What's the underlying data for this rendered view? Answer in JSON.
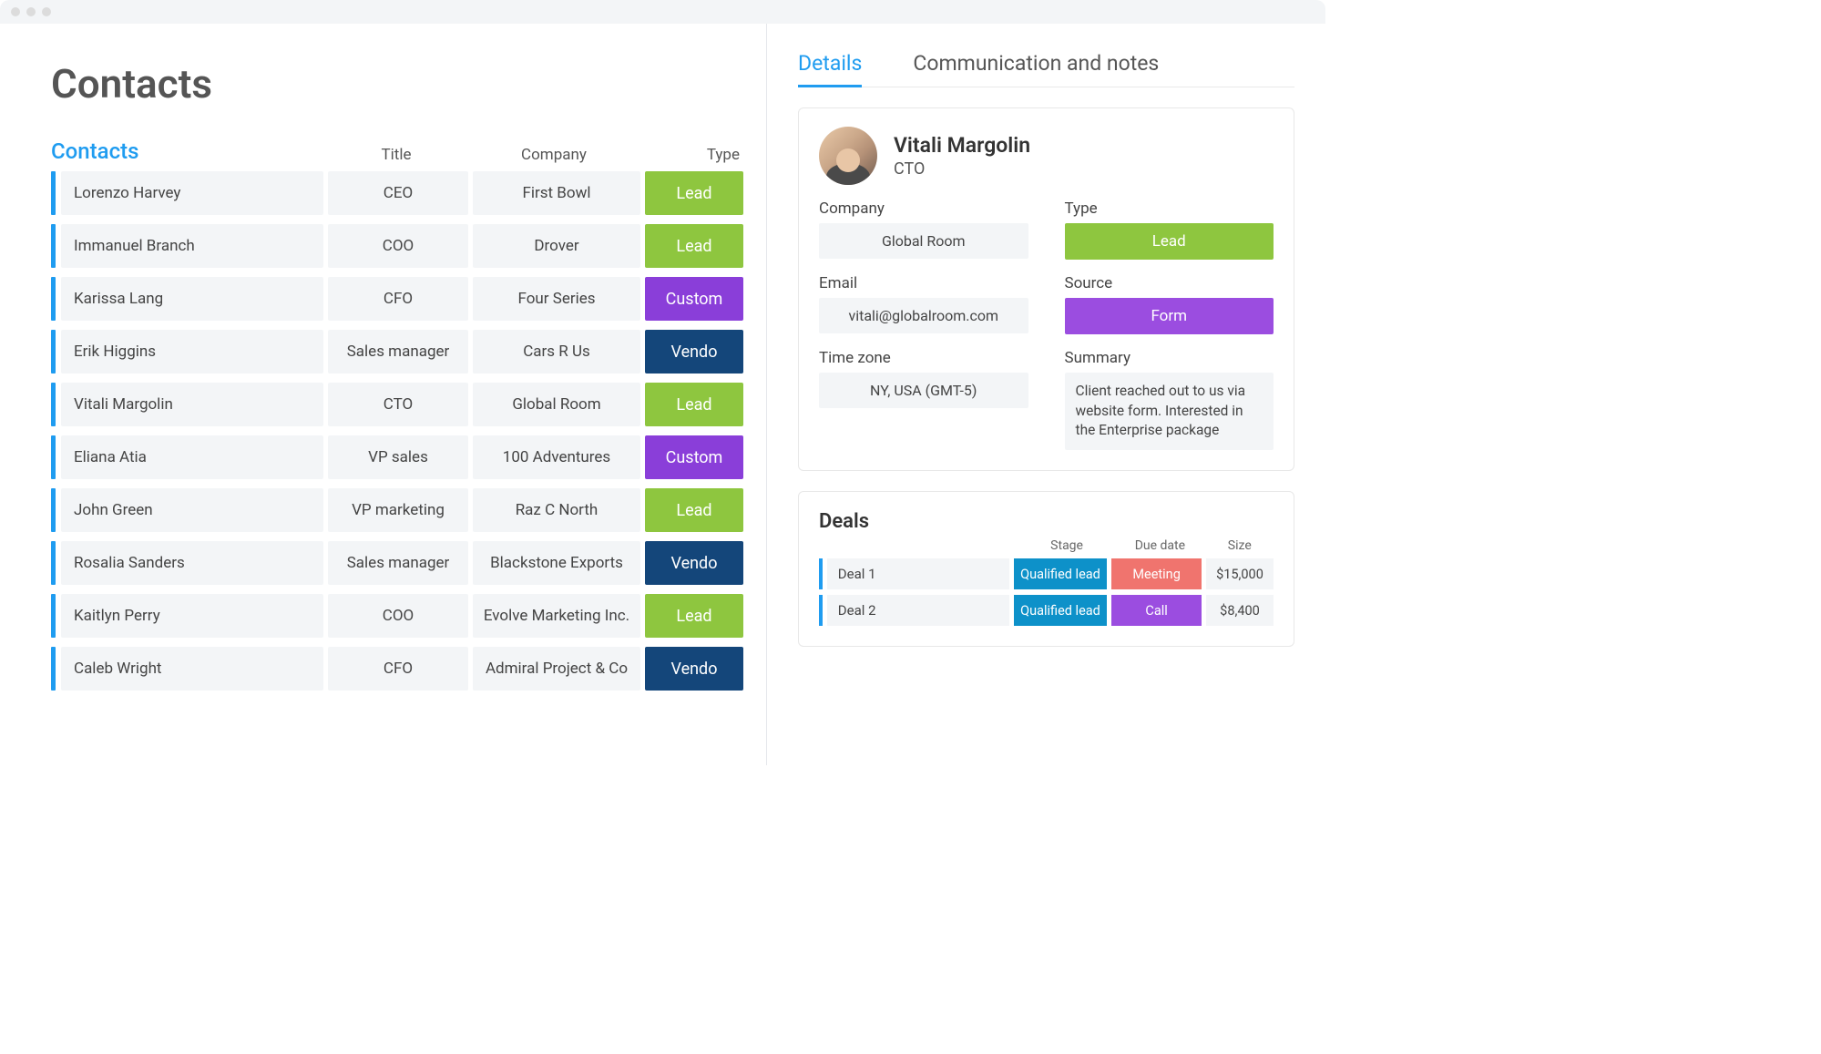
{
  "page_title": "Contacts",
  "table": {
    "header": {
      "contacts": "Contacts",
      "title": "Title",
      "company": "Company",
      "type": "Type"
    },
    "rows": [
      {
        "name": "Lorenzo Harvey",
        "title": "CEO",
        "company": "First Bowl",
        "type": "Lead",
        "type_class": "type-lead"
      },
      {
        "name": "Immanuel Branch",
        "title": "COO",
        "company": "Drover",
        "type": "Lead",
        "type_class": "type-lead"
      },
      {
        "name": "Karissa Lang",
        "title": "CFO",
        "company": "Four Series",
        "type": "Custom",
        "type_class": "type-customer"
      },
      {
        "name": "Erik Higgins",
        "title": "Sales manager",
        "company": "Cars R Us",
        "type": "Vendo",
        "type_class": "type-vendor"
      },
      {
        "name": "Vitali Margolin",
        "title": "CTO",
        "company": "Global Room",
        "type": "Lead",
        "type_class": "type-lead"
      },
      {
        "name": "Eliana Atia",
        "title": "VP sales",
        "company": "100 Adventures",
        "type": "Custom",
        "type_class": "type-customer"
      },
      {
        "name": "John Green",
        "title": "VP marketing",
        "company": "Raz C North",
        "type": "Lead",
        "type_class": "type-lead"
      },
      {
        "name": "Rosalia Sanders",
        "title": "Sales manager",
        "company": "Blackstone Exports",
        "type": "Vendo",
        "type_class": "type-vendor"
      },
      {
        "name": "Kaitlyn Perry",
        "title": "COO",
        "company": "Evolve Marketing Inc.",
        "type": "Lead",
        "type_class": "type-lead"
      },
      {
        "name": "Caleb Wright",
        "title": "CFO",
        "company": "Admiral Project & Co",
        "type": "Vendo",
        "type_class": "type-vendor"
      }
    ]
  },
  "tabs": {
    "details": "Details",
    "comms": "Communication and notes"
  },
  "profile": {
    "name": "Vitali Margolin",
    "role": "CTO",
    "labels": {
      "company": "Company",
      "type": "Type",
      "email": "Email",
      "source": "Source",
      "timezone": "Time zone",
      "summary": "Summary"
    },
    "company": "Global Room",
    "type": "Lead",
    "email": "vitali@globalroom.com",
    "source": "Form",
    "timezone": "NY, USA (GMT-5)",
    "summary": "Client reached out to us via website form. Interested in the Enterprise package"
  },
  "deals": {
    "title": "Deals",
    "header": {
      "stage": "Stage",
      "due": "Due date",
      "size": "Size"
    },
    "rows": [
      {
        "name": "Deal 1",
        "stage": "Qualified lead",
        "due": "Meeting",
        "due_class": "due-meeting",
        "size": "$15,000"
      },
      {
        "name": "Deal 2",
        "stage": "Qualified lead",
        "due": "Call",
        "due_class": "due-call",
        "size": "$8,400"
      }
    ]
  }
}
